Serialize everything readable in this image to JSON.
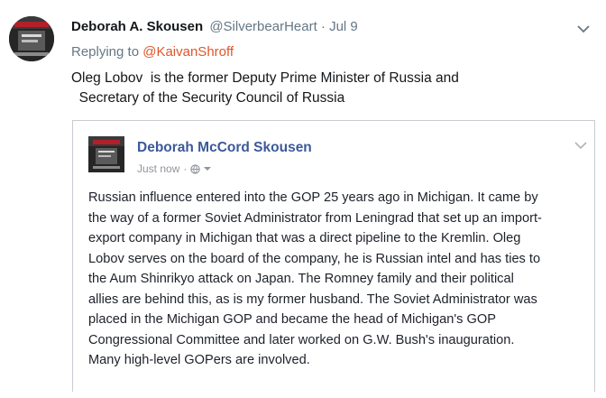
{
  "tweet": {
    "author_name": "Deborah A. Skousen",
    "handle": "@SilverbearHeart",
    "separator": "·",
    "date": "Jul 9",
    "replying_prefix": "Replying to",
    "replying_to": "@KaivanShroff",
    "text_lines": [
      "Oleg Lobov  is the former Deputy Prime Minister of Russia and",
      "  Secretary of the Security Council of Russia"
    ],
    "menu_icon": "chevron-down-icon"
  },
  "facebook_post": {
    "author_name": "Deborah McCord Skousen",
    "time": "Just now",
    "separator": "·",
    "audience_icon": "globe-icon",
    "body_lines": [
      "Russian influence entered into the GOP 25 years ago in Michigan. It came by",
      "the way of a former Soviet Administrator from Leningrad that set up an import-",
      "export company in Michigan that was a direct pipeline to the Kremlin. Oleg",
      "Lobov serves on the board of the company, he is Russian intel and has ties to",
      "the Aum Shinrikyo attack on Japan. The Romney family and their political",
      "allies are behind this, as is my former husband. The Soviet Administrator was",
      "placed in the Michigan GOP and became the head of Michigan's GOP",
      "Congressional Committee and later worked on G.W. Bush's inauguration.",
      "Many high-level GOPers are involved."
    ]
  },
  "colors": {
    "mention": "#e0552b",
    "facebook_name": "#3b5998",
    "muted": "#657786"
  }
}
